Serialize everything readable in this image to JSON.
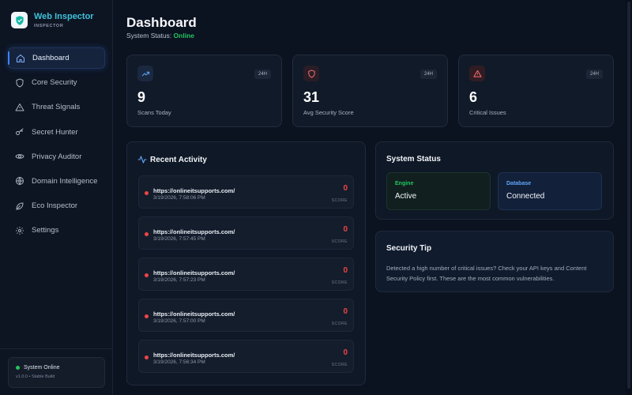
{
  "app": {
    "title": "Web Inspector",
    "subtitle": "INSPECTOR"
  },
  "sidebar": {
    "items": [
      {
        "label": "Dashboard",
        "icon": "home-icon",
        "active": true
      },
      {
        "label": "Core Security",
        "icon": "shield-icon"
      },
      {
        "label": "Threat Signals",
        "icon": "warning-icon"
      },
      {
        "label": "Secret Hunter",
        "icon": "key-icon"
      },
      {
        "label": "Privacy Auditor",
        "icon": "eye-icon"
      },
      {
        "label": "Domain Intelligence",
        "icon": "globe-icon"
      },
      {
        "label": "Eco Inspector",
        "icon": "leaf-icon"
      },
      {
        "label": "Settings",
        "icon": "gear-icon"
      }
    ],
    "footer": {
      "status": "System Online",
      "version": "v1.0.0 • Stable Build"
    }
  },
  "header": {
    "title": "Dashboard",
    "status_label": "System Status:",
    "status_value": "Online"
  },
  "stats": [
    {
      "value": "9",
      "label": "Scans Today",
      "badge": "24H",
      "icon": "trend-up-icon",
      "color": "#60a5fa"
    },
    {
      "value": "31",
      "label": "Avg Security Score",
      "badge": "24H",
      "icon": "shield-icon",
      "color": "#f87171"
    },
    {
      "value": "6",
      "label": "Critical Issues",
      "badge": "24H",
      "icon": "warning-icon",
      "color": "#f87171"
    }
  ],
  "activity": {
    "title": "Recent Activity",
    "items": [
      {
        "url": "https://onlineitsupports.com/",
        "time": "3/19/2026, 7:58:06 PM",
        "score": "0",
        "score_label": "SCORE"
      },
      {
        "url": "https://onlineitsupports.com/",
        "time": "3/19/2026, 7:57:45 PM",
        "score": "0",
        "score_label": "SCORE"
      },
      {
        "url": "https://onlineitsupports.com/",
        "time": "3/19/2026, 7:57:23 PM",
        "score": "0",
        "score_label": "SCORE"
      },
      {
        "url": "https://onlineitsupports.com/",
        "time": "3/19/2026, 7:57:00 PM",
        "score": "0",
        "score_label": "SCORE"
      },
      {
        "url": "https://onlineitsupports.com/",
        "time": "3/19/2026, 7:56:34 PM",
        "score": "0",
        "score_label": "SCORE"
      }
    ]
  },
  "system_status": {
    "title": "System Status",
    "engine": {
      "label": "Engine",
      "value": "Active"
    },
    "database": {
      "label": "Database",
      "value": "Connected"
    }
  },
  "tip": {
    "title": "Security Tip",
    "text": "Detected a high number of critical issues? Check your API keys and Content Security Policy first. These are the most common vulnerabilities."
  },
  "colors": {
    "accent": "#3b82f6",
    "brand": "#3fc1d9",
    "online": "#22c55e",
    "danger": "#ef4444"
  }
}
